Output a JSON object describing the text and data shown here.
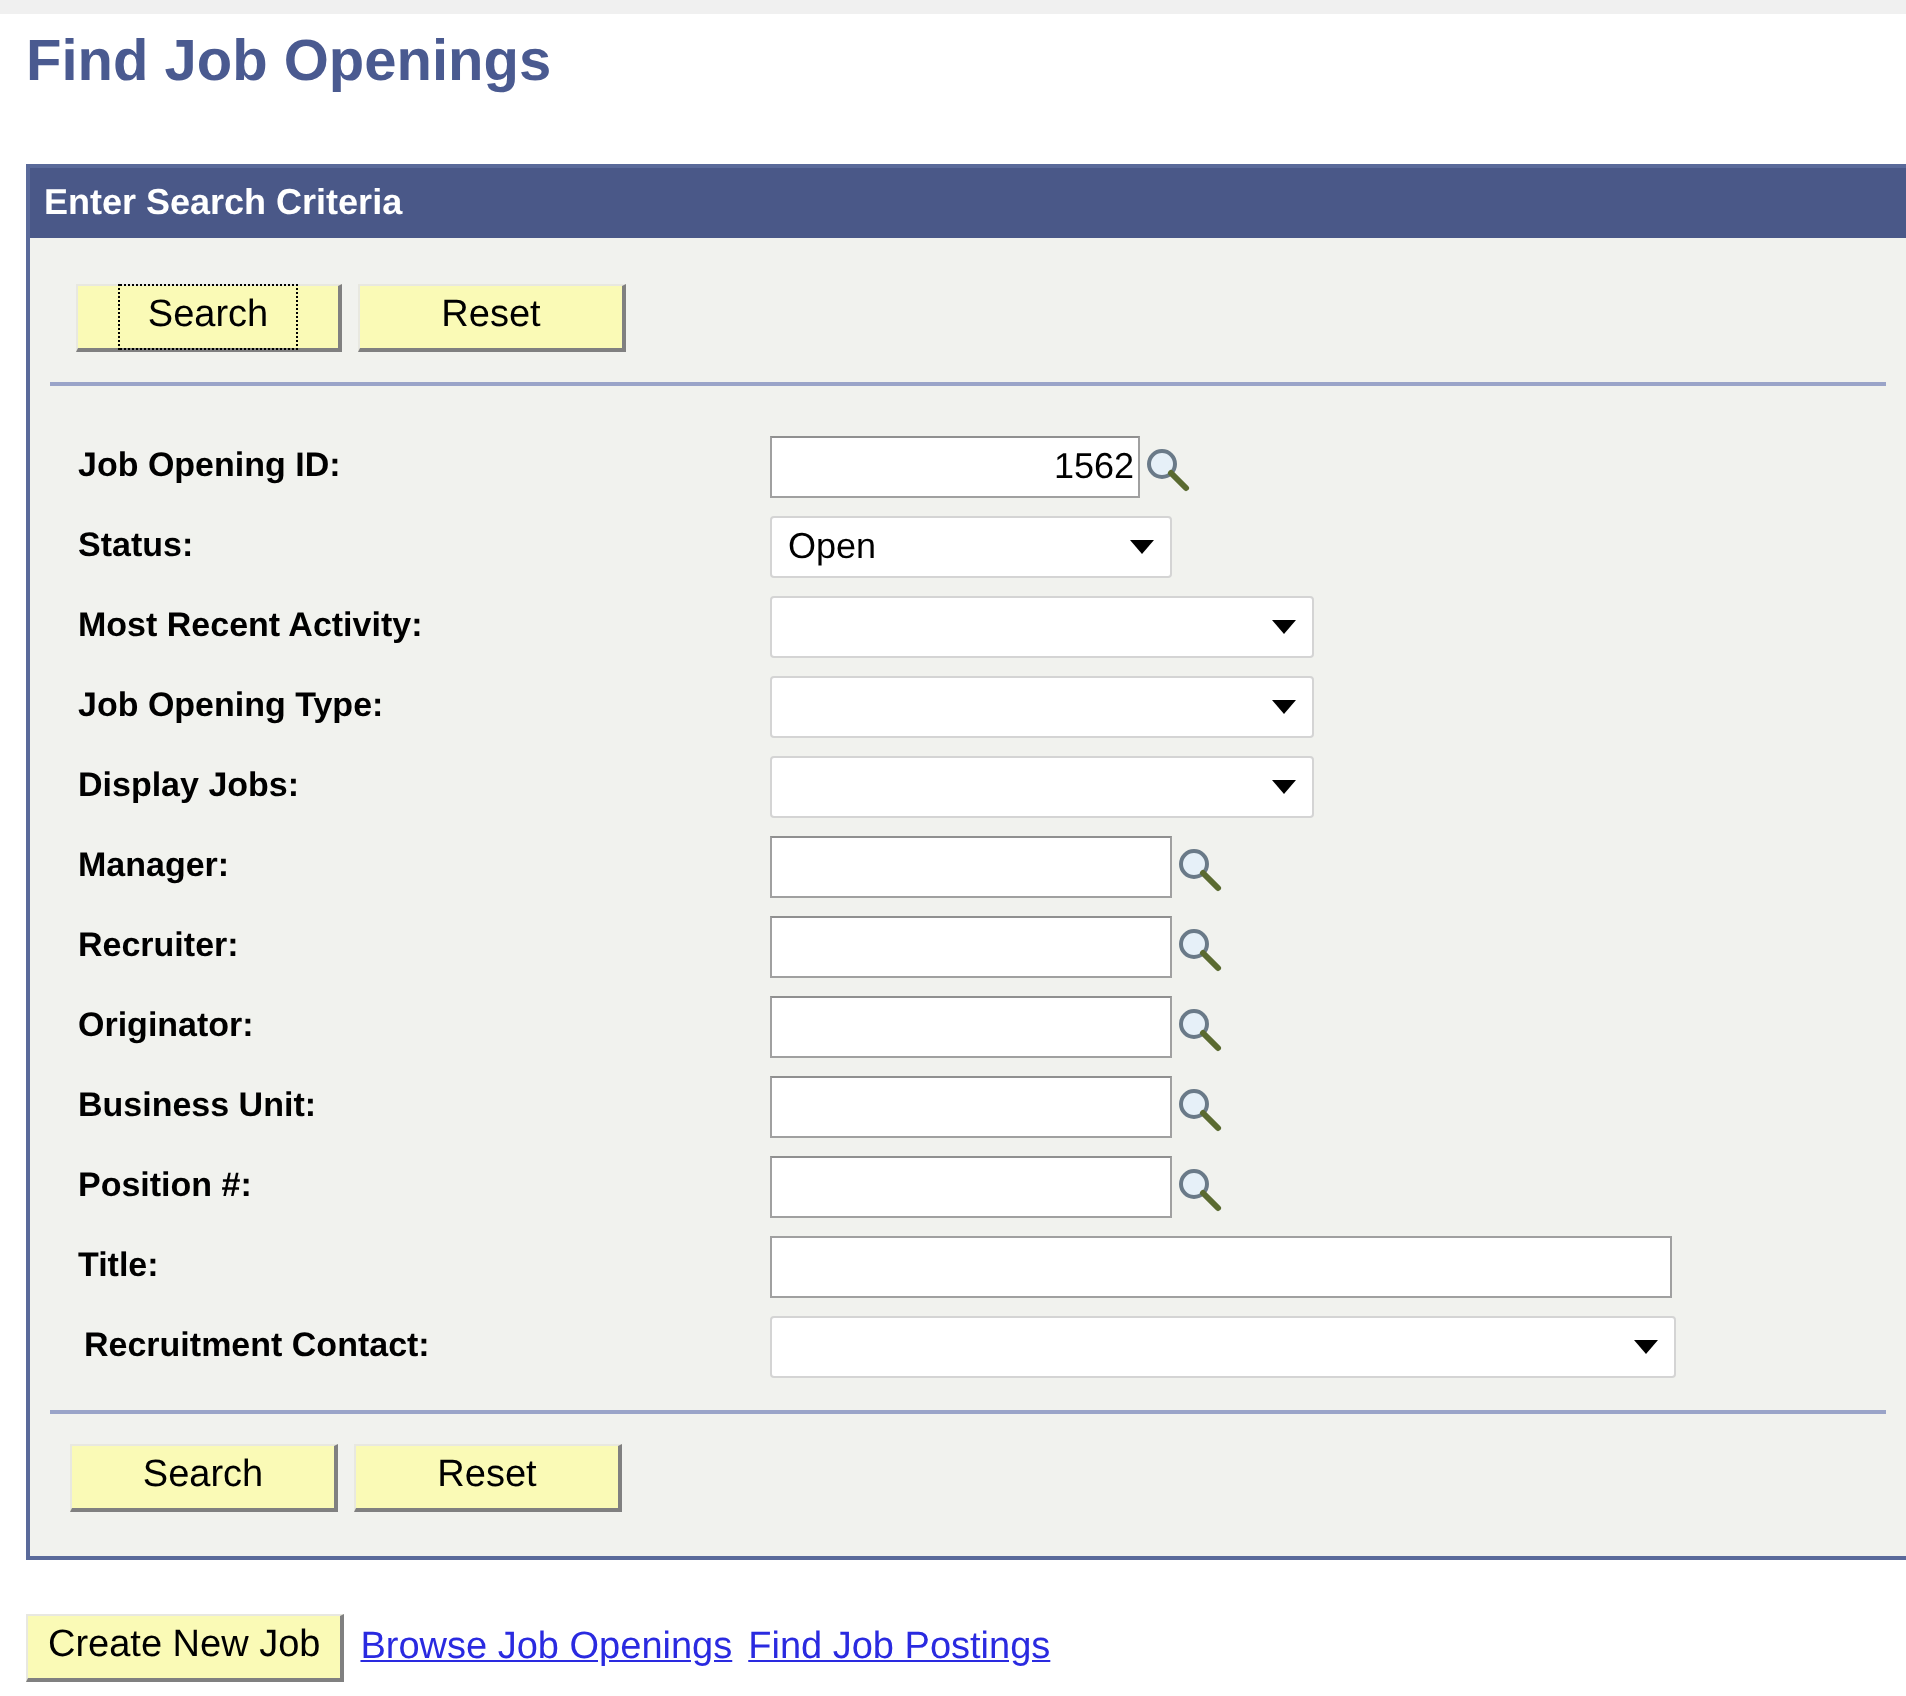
{
  "page_title": "Find Job Openings",
  "panel": {
    "title": "Enter Search Criteria",
    "top_buttons": [
      {
        "label": "Search",
        "focused": true
      },
      {
        "label": "Reset",
        "focused": false
      }
    ],
    "fields": [
      {
        "label": "Job Opening ID:",
        "kind": "lookup",
        "value": "1562"
      },
      {
        "label": "Status:",
        "kind": "select",
        "value": "Open"
      },
      {
        "label": "Most Recent Activity:",
        "kind": "select"
      },
      {
        "label": "Job Opening Type:",
        "kind": "select"
      },
      {
        "label": "Display Jobs:",
        "kind": "select"
      },
      {
        "label": "Manager:",
        "kind": "lookup"
      },
      {
        "label": "Recruiter:",
        "kind": "lookup"
      },
      {
        "label": "Originator:",
        "kind": "lookup"
      },
      {
        "label": "Business Unit:",
        "kind": "lookup"
      },
      {
        "label": "Position #:",
        "kind": "lookup"
      },
      {
        "label": "Title:",
        "kind": "text"
      },
      {
        "label": "Recruitment Contact:",
        "kind": "select"
      }
    ],
    "bottom_buttons": [
      {
        "label": "Search",
        "focused": false
      },
      {
        "label": "Reset",
        "focused": false
      }
    ]
  },
  "footer": {
    "button": "Create New Job",
    "links": [
      "Browse Job Openings",
      "Find Job Postings"
    ]
  }
}
